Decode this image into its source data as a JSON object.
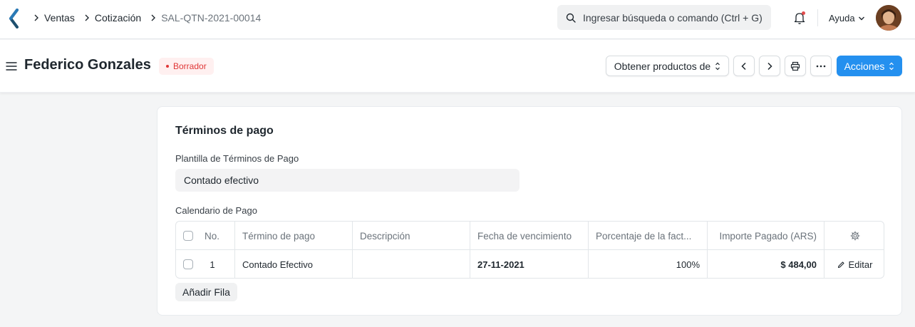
{
  "navbar": {
    "breadcrumbs": [
      "Ventas",
      "Cotización",
      "SAL-QTN-2021-00014"
    ],
    "search_placeholder": "Ingresar búsqueda o comando (Ctrl + G)",
    "help_label": "Ayuda"
  },
  "page": {
    "title": "Federico Gonzales",
    "status": "Borrador",
    "get_items_label": "Obtener productos de",
    "actions_label": "Acciones"
  },
  "section": {
    "title": "Términos de pago",
    "template_label": "Plantilla de Términos de Pago",
    "template_value": "Contado efectivo",
    "schedule_label": "Calendario de Pago",
    "add_row_label": "Añadir Fila"
  },
  "table": {
    "headers": [
      "No.",
      "Término de pago",
      "Descripción",
      "Fecha de vencimiento",
      "Porcentaje de la fact...",
      "Importe Pagado (ARS)"
    ],
    "rows": [
      {
        "no": "1",
        "term": "Contado Efectivo",
        "description": "",
        "due_date": "27-11-2021",
        "percentage": "100%",
        "amount": "$ 484,00",
        "edit_label": "Editar"
      }
    ]
  },
  "colors": {
    "primary": "#2490ef",
    "draft_badge_text": "#e03636",
    "draft_badge_bg": "#fff0f0"
  },
  "icons": [
    "back-logo-icon",
    "chevron-right-icon",
    "search-icon",
    "bell-icon",
    "chevron-down-icon",
    "hamburger-icon",
    "sort-icon",
    "chevron-left-icon",
    "printer-icon",
    "more-icon",
    "gear-icon",
    "pencil-icon"
  ]
}
